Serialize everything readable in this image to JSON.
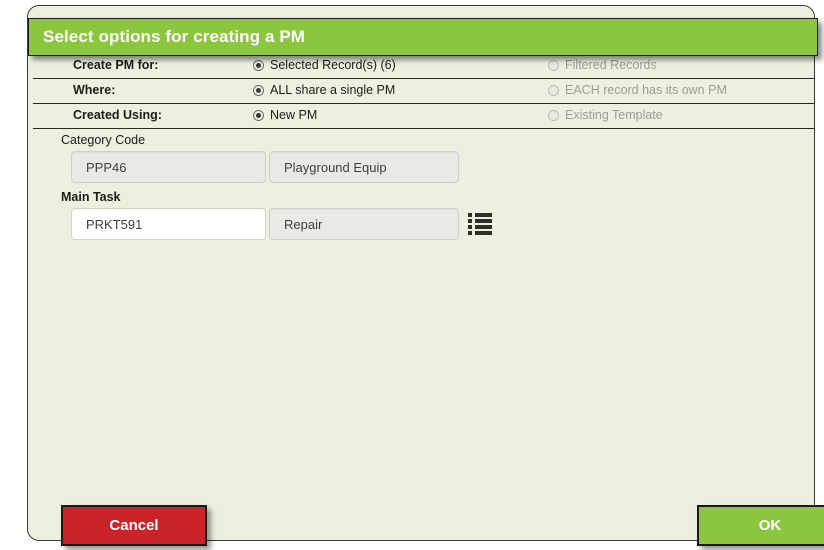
{
  "dialog": {
    "title": "Select options for creating a PM",
    "accent_green": "#8cc63e",
    "accent_red": "#cc2229",
    "panel_bg": "#eeeee1"
  },
  "options": [
    {
      "label": "Create PM for:",
      "choice_a": {
        "text": "Selected Record(s) (6)",
        "selected": true,
        "disabled": false
      },
      "choice_b": {
        "text": "Filtered Records",
        "selected": false,
        "disabled": true
      }
    },
    {
      "label": "Where:",
      "choice_a": {
        "text": "ALL share a single PM",
        "selected": true,
        "disabled": false
      },
      "choice_b": {
        "text": "EACH record has its own PM",
        "selected": false,
        "disabled": true
      }
    },
    {
      "label": "Created Using:",
      "choice_a": {
        "text": "New PM",
        "selected": true,
        "disabled": false
      },
      "choice_b": {
        "text": "Existing Template",
        "selected": false,
        "disabled": true
      }
    }
  ],
  "fields": {
    "category": {
      "label": "Category Code",
      "code_value": "PPP46",
      "desc_value": "Playground Equip"
    },
    "main_task": {
      "label": "Main Task",
      "code_value": "PRKT591",
      "desc_value": "Repair",
      "lookup_icon": "list-lookup-icon"
    }
  },
  "buttons": {
    "cancel": "Cancel",
    "ok": "OK"
  }
}
